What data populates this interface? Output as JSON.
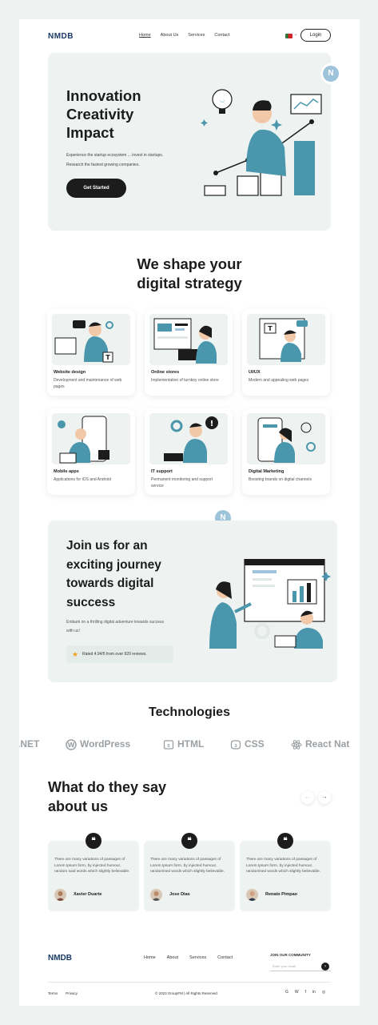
{
  "nav": {
    "logo": "NMDB",
    "items": [
      "Home",
      "About Us",
      "Services",
      "Contact"
    ],
    "flag_caret": "⌄",
    "login": "Login"
  },
  "hero": {
    "title_lines": [
      "Innovation",
      "Creativity",
      "Impact"
    ],
    "subtitle_lines": [
      "Experience the startup ecosystem ... invest in startups.",
      "Research the fastest growing companies."
    ],
    "cta": "Get Started",
    "badge": "N"
  },
  "services": {
    "title_lines": [
      "We shape your",
      "digital strategy"
    ],
    "cards": [
      {
        "title": "Website design",
        "desc": "Development and maintenance of web pages"
      },
      {
        "title": "Online stores",
        "desc": "Implementation of turnkey online store"
      },
      {
        "title": "UI/UX",
        "desc": "Modern and appealing web pages"
      },
      {
        "title": "Mobile apps",
        "desc": "Applications for iOS and Android"
      },
      {
        "title": "IT support",
        "desc": "Permanent monitoring and support service"
      },
      {
        "title": "Digital Marketing",
        "desc": "Boosting brands on digital channels"
      }
    ]
  },
  "join": {
    "title_lines": [
      "Join us for an",
      "exciting journey",
      "towards digital",
      "success"
    ],
    "subtitle_lines": [
      "Embark on a thrilling digital adventure towards success",
      "with us!"
    ],
    "rated": "Rated 4.94/5 from over 920 reviews.",
    "star": "★",
    "badge": "N"
  },
  "technologies": {
    "title": "Technologies",
    "items": [
      ".NET",
      "WordPress",
      "HTML",
      "CSS",
      "React Nat"
    ]
  },
  "testimonials": {
    "title_lines": [
      "What do they say",
      "about us"
    ],
    "prev": "←",
    "next": "→",
    "quote_mark": "❝",
    "items": [
      {
        "text": "There are many variations of passages of Lorem Ipsum form, by injected humour, random said words which slightly believable.",
        "name": "Xavier Duarte"
      },
      {
        "text": "There are many variations of passages of Lorem Ipsum form, by injected humour, randomised words which slightly believable.",
        "name": "Jose Dias"
      },
      {
        "text": "There are many variations of passages of Lorem Ipsum form, by injected humour, randomised words which slightly believable.",
        "name": "Renato Pimpao"
      }
    ]
  },
  "footer": {
    "logo": "NMDB",
    "menu": [
      "Home",
      "About",
      "Services",
      "Contact"
    ],
    "community": "JOIN OUR COMMUNITY",
    "email_placeholder": "Enter your email",
    "go": "›",
    "links": [
      "Terms",
      "Privacy"
    ],
    "copyright": "© 2023 GroupFM | All Rights Reserved",
    "socials": [
      "G",
      "W",
      "f",
      "in",
      "◎"
    ]
  },
  "colors": {
    "accent": "#4a97ad",
    "panel": "#eef3f2",
    "dark": "#1c1c1c",
    "brand_blue": "#1a3a66"
  }
}
